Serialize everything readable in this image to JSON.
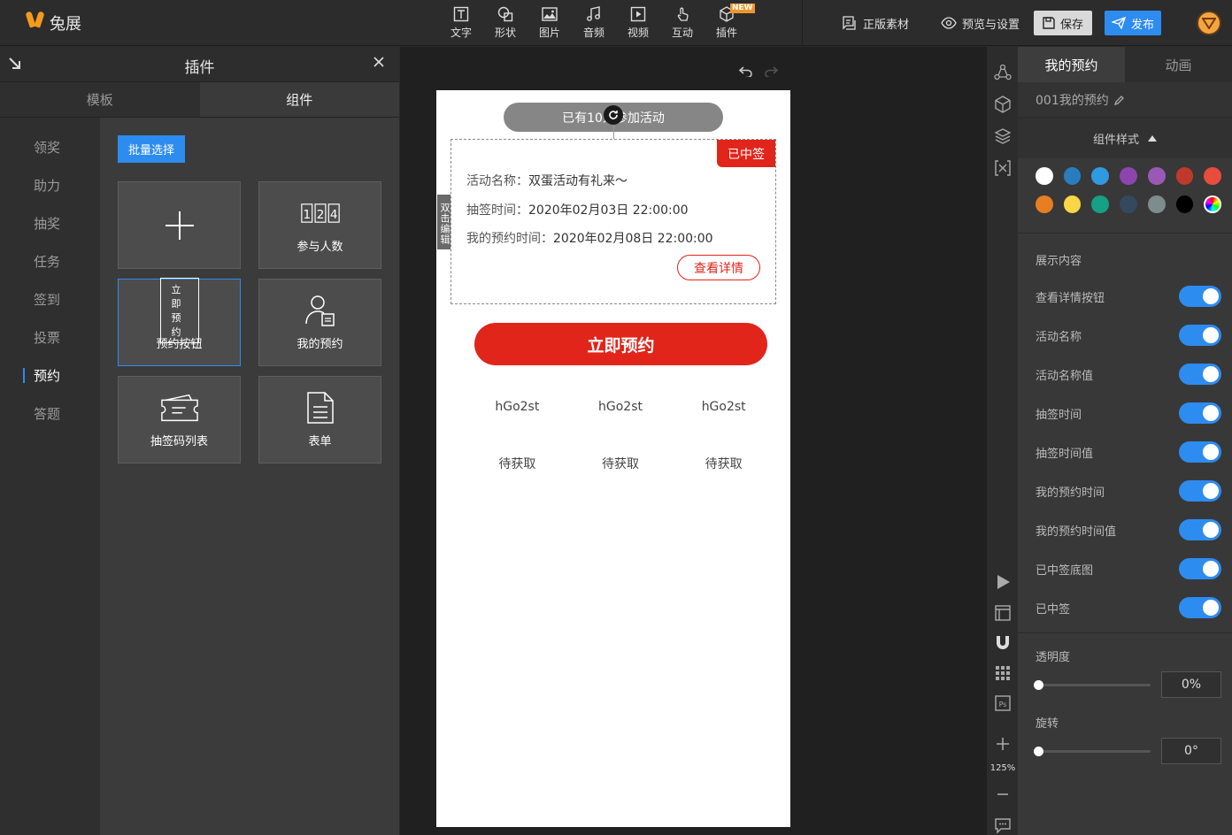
{
  "app": {
    "logo_text": "兔展"
  },
  "toolbar": {
    "tools": [
      {
        "label": "文字",
        "icon": "text-icon"
      },
      {
        "label": "形状",
        "icon": "shape-icon"
      },
      {
        "label": "图片",
        "icon": "image-icon"
      },
      {
        "label": "音频",
        "icon": "music-icon"
      },
      {
        "label": "视频",
        "icon": "video-icon"
      },
      {
        "label": "互动",
        "icon": "tap-icon"
      },
      {
        "label": "插件",
        "icon": "cube-icon",
        "badge": "NEW"
      }
    ],
    "assets_label": "正版素材",
    "preview_label": "预览与设置",
    "save_label": "保存",
    "publish_label": "发布"
  },
  "left_panel": {
    "title": "插件",
    "tabs": [
      "模板",
      "组件"
    ],
    "active_tab": 1,
    "nav": [
      "领奖",
      "助力",
      "抽奖",
      "任务",
      "签到",
      "投票",
      "预约",
      "答题"
    ],
    "active_nav": 6,
    "batch_label": "批量选择",
    "cards": [
      {
        "label": "",
        "icon": "plus-icon"
      },
      {
        "label": "参与人数",
        "icon": "counter-icon"
      },
      {
        "label": "预约按钮",
        "icon": "button-icon",
        "mini": "立即预约"
      },
      {
        "label": "我的预约",
        "icon": "user-card-icon"
      },
      {
        "label": "抽签码列表",
        "icon": "ticket-icon"
      },
      {
        "label": "表单",
        "icon": "document-icon"
      }
    ]
  },
  "phone": {
    "count_text": "已有10人参加活动",
    "edit_hint": "双击编辑",
    "win_tag": "已中签",
    "activity_key": "活动名称：",
    "activity_val": "双蛋活动有礼来～",
    "draw_key": "抽签时间：",
    "draw_val": "2020年02月03日 22:00:00",
    "my_key": "我的预约时间：",
    "my_val": "2020年02月08日 22:00:00",
    "detail_label": "查看详情",
    "reserve_label": "立即预约",
    "codes": [
      "hGo2st",
      "hGo2st",
      "hGo2st"
    ],
    "pending": [
      "待获取",
      "待获取",
      "待获取"
    ]
  },
  "strip": {
    "zoom": "125%"
  },
  "right_panel": {
    "tabs": [
      "我的预约",
      "动画"
    ],
    "component_name": "001我的预约",
    "style_header": "组件样式",
    "swatches_row1": [
      "#ffffff",
      "#2a7cc0",
      "#3199e0",
      "#8e44ad",
      "#9b59b6",
      "#c0392b",
      "#e74c3c"
    ],
    "swatches_row2": [
      "#e67e22",
      "#f9d548",
      "#16a085",
      "#34495e",
      "#7f8c8d",
      "#000000"
    ],
    "content_title": "展示内容",
    "toggles": [
      "查看详情按钮",
      "活动名称",
      "活动名称值",
      "抽签时间",
      "抽签时间值",
      "我的预约时间",
      "我的预约时间值",
      "已中签底图",
      "已中签"
    ],
    "opacity_label": "透明度",
    "opacity_value": "0%",
    "rotate_label": "旋转",
    "rotate_value": "0°"
  }
}
